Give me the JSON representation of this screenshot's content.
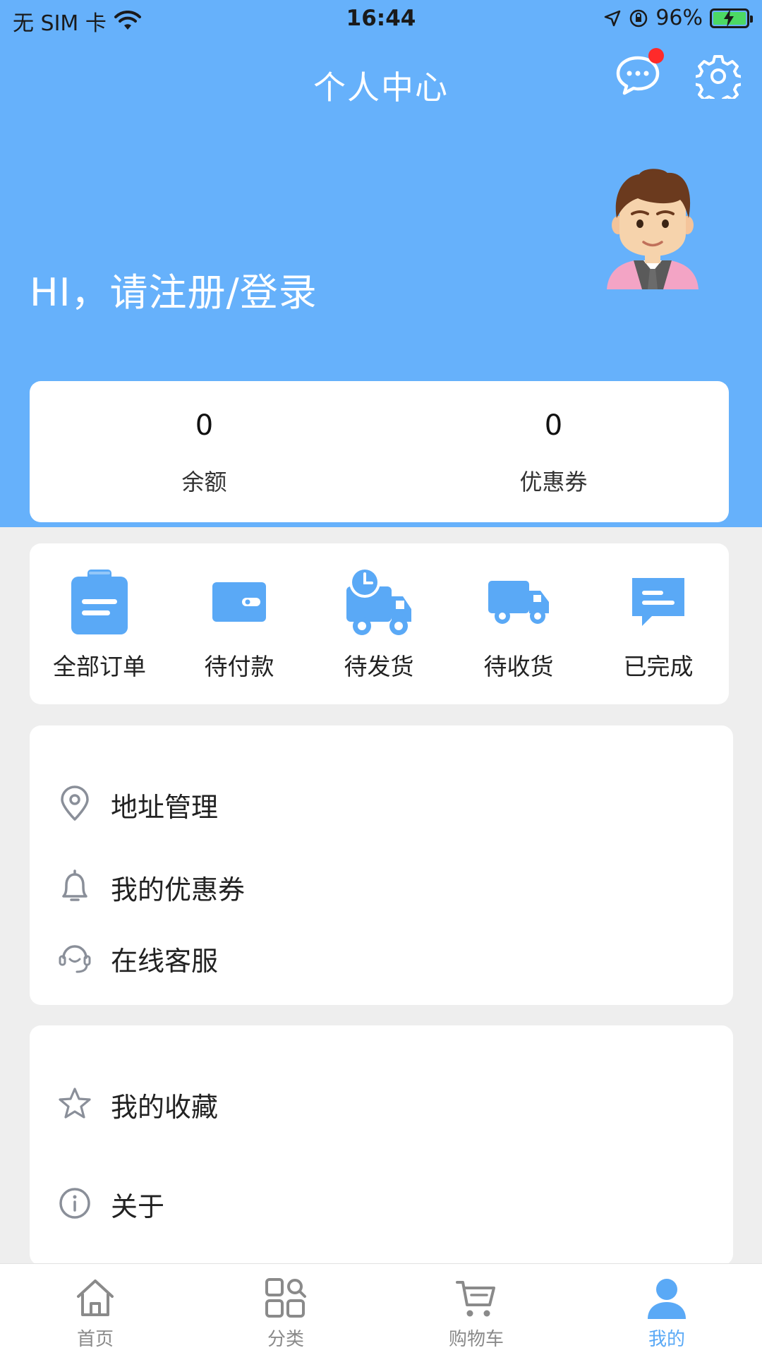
{
  "status_bar": {
    "carrier": "无 SIM 卡",
    "time": "16:44",
    "battery": "96%"
  },
  "header": {
    "title": "个人中心",
    "message_icon": "chat-bubble-icon",
    "settings_icon": "gear-icon"
  },
  "profile": {
    "greeting": "HI，请注册/登录",
    "avatar_icon": "cartoon-man-avatar"
  },
  "stats": [
    {
      "value": "0",
      "label": "余额"
    },
    {
      "value": "0",
      "label": "优惠券"
    }
  ],
  "orders": [
    {
      "label": "全部订单",
      "icon": "clipboard-icon"
    },
    {
      "label": "待付款",
      "icon": "wallet-icon"
    },
    {
      "label": "待发货",
      "icon": "truck-clock-icon"
    },
    {
      "label": "待收货",
      "icon": "truck-icon"
    },
    {
      "label": "已完成",
      "icon": "message-icon"
    }
  ],
  "menu_group_1": [
    {
      "label": "地址管理",
      "icon": "location-pin-icon"
    },
    {
      "label": "我的优惠券",
      "icon": "bell-icon"
    },
    {
      "label": "在线客服",
      "icon": "headset-icon"
    }
  ],
  "menu_group_2": [
    {
      "label": "我的收藏",
      "icon": "star-icon"
    },
    {
      "label": "关于",
      "icon": "info-icon"
    }
  ],
  "tabbar": [
    {
      "label": "首页",
      "icon": "home-icon"
    },
    {
      "label": "分类",
      "icon": "category-icon"
    },
    {
      "label": "购物车",
      "icon": "cart-icon"
    },
    {
      "label": "我的",
      "icon": "user-icon"
    }
  ],
  "colors": {
    "primary": "#66b1fb",
    "icon_blue": "#5aa9f6",
    "badge_red": "#ff2a2a",
    "tab_inactive": "#8a8a8a"
  }
}
